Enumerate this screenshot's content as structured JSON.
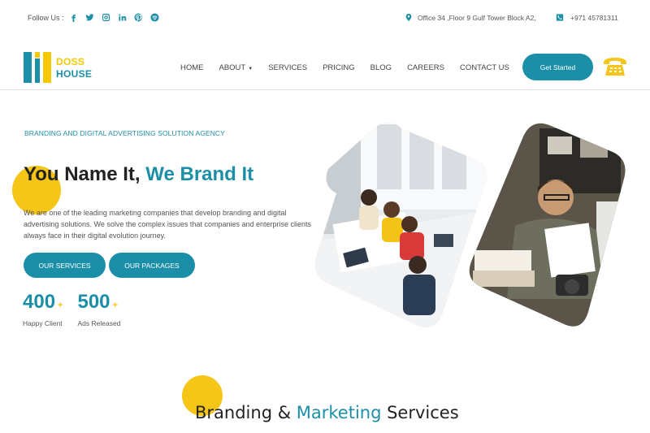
{
  "topbar": {
    "follow_label": "Follow Us :",
    "social_icons": [
      "facebook-icon",
      "twitter-icon",
      "instagram-icon",
      "linkedin-icon",
      "pinterest-icon",
      "skype-icon"
    ],
    "address": "Office 34 ,Floor 9 Gulf Tower Block A2,",
    "phone": "+971 45781311"
  },
  "header": {
    "logo_line1": "DOSS",
    "logo_line2": "HOUSE",
    "nav": [
      "HOME",
      "ABOUT",
      "SERVICES",
      "PRICING",
      "BLOG",
      "CAREERS",
      "CONTACT US"
    ],
    "cta": "Get Started"
  },
  "hero": {
    "tagline": "BRANDING AND DIGITAL ADVERTISING SOLUTION AGENCY",
    "title_part1": "You Name It, ",
    "title_part2": "We Brand It",
    "description": "We are one of the leading marketing companies that develop branding and digital advertising solutions. We solve the complex issues that companies and enterprise clients always face in their digital evolution journey.",
    "button_services": "OUR SERVICES",
    "button_packages": "OUR PACKAGES",
    "stats": [
      {
        "value": "400",
        "suffix": "+",
        "label": "Happy Client"
      },
      {
        "value": "500",
        "suffix": "+",
        "label": "Ads Released"
      }
    ]
  },
  "section": {
    "title_part1": "Branding & ",
    "title_part2": "Marketing",
    "title_part3": " Services"
  },
  "colors": {
    "accent": "#1b8fa8",
    "yellow": "#f5c518"
  }
}
